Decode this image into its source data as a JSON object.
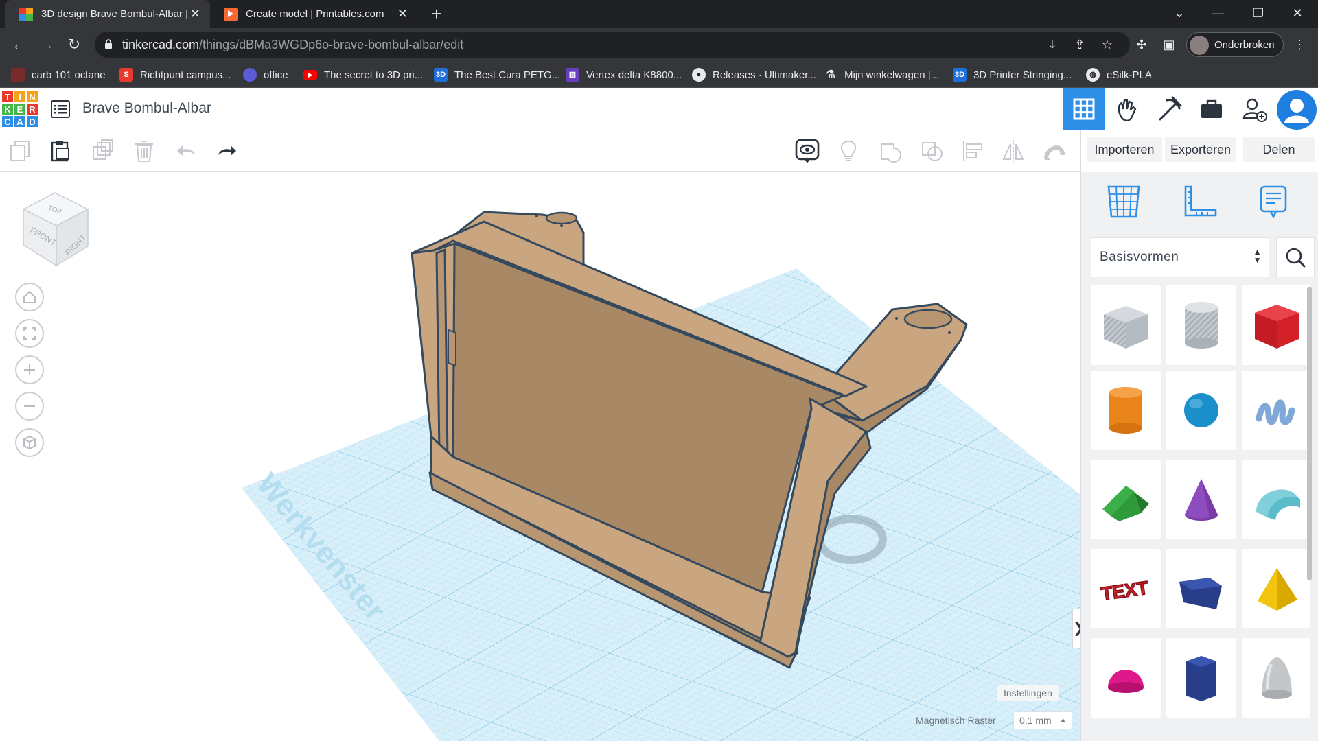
{
  "browser": {
    "tabs": [
      {
        "title": "3D design Brave Bombul-Albar |",
        "active": true
      },
      {
        "title": "Create model | Printables.com",
        "active": false
      }
    ],
    "url_host": "tinkercad.com",
    "url_path": "/things/dBMa3WGDp6o-brave-bombul-albar/edit",
    "profile_label": "Onderbroken",
    "bookmarks": [
      {
        "label": "carb 101 octane",
        "icon": "image-favicon",
        "color": "#7a2a2a"
      },
      {
        "label": "Richtpunt campus...",
        "icon": "s-favicon",
        "color": "#e8392c"
      },
      {
        "label": "office",
        "icon": "office-favicon",
        "color": "#5b5bd6"
      },
      {
        "label": "The secret to 3D pri...",
        "icon": "youtube-favicon",
        "color": "#ff0000"
      },
      {
        "label": "The Best Cura PETG...",
        "icon": "3d-favicon",
        "color": "#1e6fd9"
      },
      {
        "label": "Vertex delta K8800...",
        "icon": "vertex-favicon",
        "color": "#6a3fbf"
      },
      {
        "label": "Releases · Ultimaker...",
        "icon": "github-favicon",
        "color": "#ffffff"
      },
      {
        "label": "Mijn winkelwagen |...",
        "icon": "cart-favicon",
        "color": "#ffffff"
      },
      {
        "label": "3D Printer Stringing...",
        "icon": "3d-favicon",
        "color": "#1e6fd9"
      },
      {
        "label": "eSilk-PLA",
        "icon": "globe-favicon",
        "color": "#ffffff"
      }
    ]
  },
  "app": {
    "logo_letters": [
      "T",
      "I",
      "N",
      "K",
      "E",
      "R",
      "C",
      "A",
      "D"
    ],
    "design_title": "Brave Bombul-Albar",
    "actions": {
      "import": "Importeren",
      "export": "Exporteren",
      "share": "Delen"
    }
  },
  "workplane": {
    "watermark": "Werkvenster",
    "viewcube": {
      "top": "TOP",
      "front": "FRONT",
      "right": "RIGHT"
    },
    "settings_label": "Instellingen",
    "snap_label": "Magnetisch Raster",
    "snap_value": "0,1 mm"
  },
  "panel": {
    "category": "Basisvormen",
    "shapes": [
      {
        "name": "box-hole",
        "color": "#b8bfc6"
      },
      {
        "name": "cylinder-hole",
        "color": "#b8bfc6"
      },
      {
        "name": "box",
        "color": "#d42029"
      },
      {
        "name": "cylinder",
        "color": "#e8841a"
      },
      {
        "name": "sphere",
        "color": "#1a8fc9"
      },
      {
        "name": "scribble",
        "color": "#7fa8d8"
      },
      {
        "name": "roof",
        "color": "#2e9a3a"
      },
      {
        "name": "cone",
        "color": "#7a3aa8"
      },
      {
        "name": "round-roof",
        "color": "#5bbcc9"
      },
      {
        "name": "text",
        "color": "#d42029",
        "label": "TEXT"
      },
      {
        "name": "polygon",
        "color": "#283e8a"
      },
      {
        "name": "pyramid",
        "color": "#f2c40f"
      },
      {
        "name": "half-sphere",
        "color": "#e0198a"
      },
      {
        "name": "hexagonal-prism",
        "color": "#283e8a"
      },
      {
        "name": "paraboloid",
        "color": "#c4c7ca"
      }
    ]
  },
  "colors": {
    "model_fill": "#c9a67f",
    "model_shade": "#a98865",
    "model_outline": "#34495e",
    "grid": "#9fd3ea",
    "accent": "#2d8fe6"
  }
}
